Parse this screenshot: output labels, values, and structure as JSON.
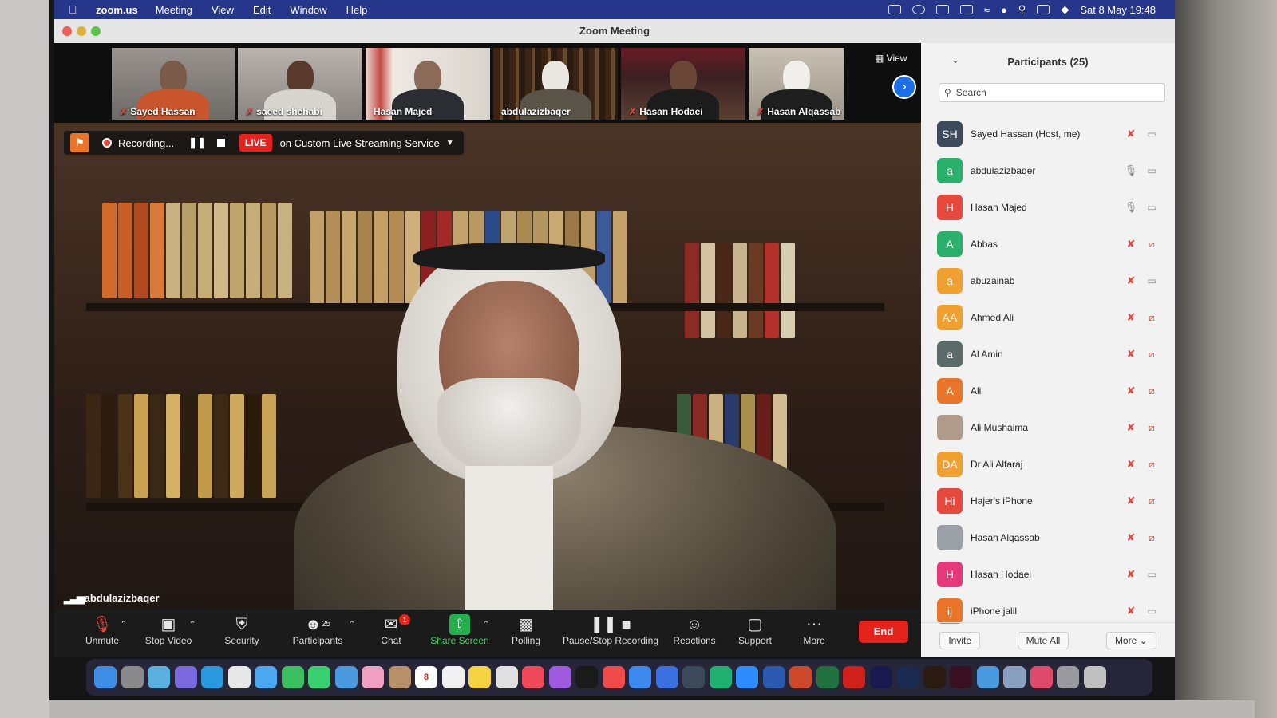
{
  "menubar": {
    "app": "zoom.us",
    "items": [
      "Meeting",
      "View",
      "Edit",
      "Window",
      "Help"
    ],
    "clock": "Sat 8 May  19:48"
  },
  "window": {
    "title": "Zoom Meeting"
  },
  "strip": {
    "view_label": "View",
    "tiles": [
      {
        "name": "Sayed Hassan",
        "muted": true
      },
      {
        "name": "saeed shehabi",
        "muted": true
      },
      {
        "name": "Hasan Majed",
        "muted": false
      },
      {
        "name": "abdulazizbaqer",
        "muted": false,
        "active": true
      },
      {
        "name": "Hasan Hodaei",
        "muted": true
      },
      {
        "name": "Hasan Alqassab",
        "muted": true
      }
    ]
  },
  "recording": {
    "status": "Recording...",
    "live_badge": "LIVE",
    "stream_label": "on Custom Live Streaming Service"
  },
  "main_video": {
    "speaker_name": "abdulazizbaqer"
  },
  "toolbar": {
    "unmute": "Unmute",
    "stop_video": "Stop Video",
    "security": "Security",
    "participants": "Participants",
    "participants_count": "25",
    "chat": "Chat",
    "chat_badge": "1",
    "share_screen": "Share Screen",
    "polling": "Polling",
    "pause_stop_recording": "Pause/Stop Recording",
    "reactions": "Reactions",
    "support": "Support",
    "more": "More",
    "end": "End"
  },
  "panel": {
    "title": "Participants (25)",
    "search_placeholder": "Search",
    "participants": [
      {
        "initials": "SH",
        "name": "Sayed Hassan (Host, me)",
        "color": "#3d4a5c",
        "mic": "muted",
        "cam": "on"
      },
      {
        "initials": "a",
        "name": "abdulazizbaqer",
        "color": "#2bb06b",
        "mic": "on",
        "cam": "on"
      },
      {
        "initials": "H",
        "name": "Hasan Majed",
        "color": "#e5483c",
        "mic": "on",
        "cam": "on"
      },
      {
        "initials": "A",
        "name": "Abbas",
        "color": "#2bb06b",
        "mic": "muted",
        "cam": "off"
      },
      {
        "initials": "a",
        "name": "abuzainab",
        "color": "#f0a030",
        "mic": "muted",
        "cam": "on"
      },
      {
        "initials": "AA",
        "name": "Ahmed Ali",
        "color": "#f0a030",
        "mic": "muted",
        "cam": "off"
      },
      {
        "initials": "a",
        "name": "Al Amin",
        "color": "#5a6b6a",
        "mic": "muted",
        "cam": "off"
      },
      {
        "initials": "A",
        "name": "Ali",
        "color": "#e8752a",
        "mic": "muted",
        "cam": "off"
      },
      {
        "initials": "",
        "name": "Ali Mushaima",
        "color": "#b09a8a",
        "mic": "muted",
        "cam": "off"
      },
      {
        "initials": "DA",
        "name": "Dr Ali Alfaraj",
        "color": "#f0a030",
        "mic": "muted",
        "cam": "off"
      },
      {
        "initials": "Hi",
        "name": "Hajer's iPhone",
        "color": "#e5483c",
        "mic": "muted",
        "cam": "off"
      },
      {
        "initials": "",
        "name": "Hasan Alqassab",
        "color": "#9aa0a6",
        "mic": "muted",
        "cam": "off"
      },
      {
        "initials": "H",
        "name": "Hasan Hodaei",
        "color": "#e53a7a",
        "mic": "muted",
        "cam": "on"
      },
      {
        "initials": "ij",
        "name": "iPhone jalil",
        "color": "#e8752a",
        "mic": "muted",
        "cam": "on"
      }
    ],
    "footer": {
      "invite": "Invite",
      "mute_all": "Mute All",
      "more": "More"
    }
  },
  "dock": {
    "calendar_day": "8",
    "apps": [
      "Finder",
      "System Preferences",
      "Preview",
      "Launchpad",
      "Safari",
      "Chrome",
      "Mail",
      "FaceTime",
      "Messages",
      "Maps",
      "Photos",
      "Contacts",
      "Calendar",
      "Reminders",
      "Notes",
      "Freeform",
      "Music",
      "Podcasts",
      "TV",
      "News",
      "App Store",
      "Xcode",
      "QuickTime",
      "Grammarly",
      "Zoom",
      "Word",
      "PowerPoint",
      "Excel",
      "Acrobat",
      "Premiere",
      "Photoshop",
      "Illustrator",
      "InDesign",
      "Remote",
      "Finder Window",
      "Creative Cloud",
      "Downloads",
      "Trash"
    ]
  }
}
